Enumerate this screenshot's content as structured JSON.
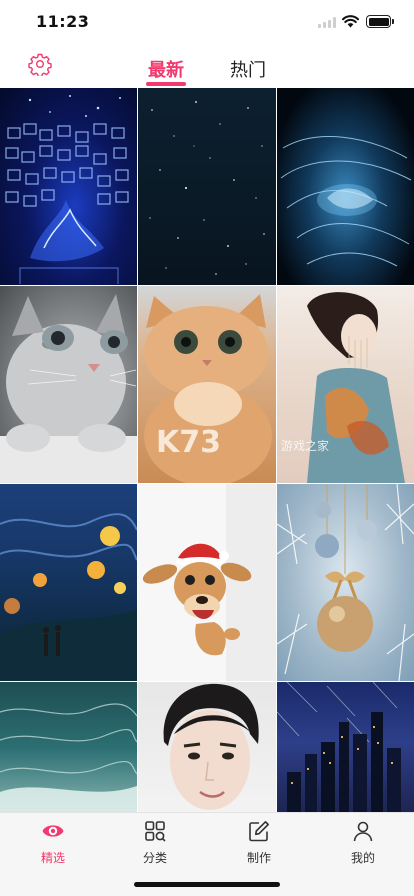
{
  "status_bar": {
    "time": "11:23"
  },
  "header": {
    "settings_icon": "gear-icon",
    "tabs": [
      {
        "label": "最新",
        "active": true
      },
      {
        "label": "热门",
        "active": false
      }
    ],
    "accent_color": "#f23a6e"
  },
  "gallery": {
    "items": [
      {
        "subject": "blue neon cube wall with dragon"
      },
      {
        "subject": "starry night sky"
      },
      {
        "subject": "glowing blue particle wave"
      },
      {
        "subject": "grey tabby kitten"
      },
      {
        "subject": "orange cat"
      },
      {
        "subject": "woman in traditional costume"
      },
      {
        "subject": "starry night painting with lanterns"
      },
      {
        "subject": "cartoon reindeer with santa hat"
      },
      {
        "subject": "christmas ornaments and snowflakes"
      },
      {
        "subject": "teal ocean waves"
      },
      {
        "subject": "man portrait"
      },
      {
        "subject": "city skyline at night"
      }
    ]
  },
  "bottom_nav": {
    "items": [
      {
        "label": "精选",
        "icon": "eye-icon",
        "active": true
      },
      {
        "label": "分类",
        "icon": "category-grid-icon",
        "active": false
      },
      {
        "label": "制作",
        "icon": "edit-icon",
        "active": false
      },
      {
        "label": "我的",
        "icon": "user-icon",
        "active": false
      }
    ]
  }
}
